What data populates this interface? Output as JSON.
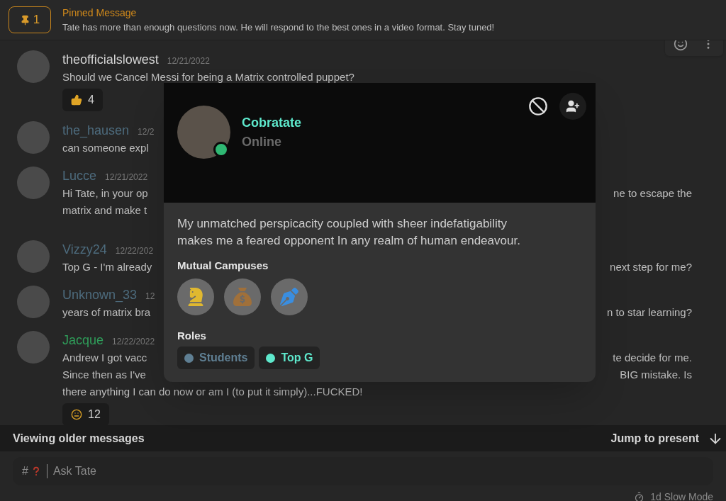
{
  "pinned": {
    "count": "1",
    "title": "Pinned Message",
    "text": "Tate has more than enough questions now. He will respond to the best ones in a video format. Stay tuned!"
  },
  "feed": [
    {
      "kind": "message",
      "author": "theofficialslowest",
      "color": "#d4d4d4",
      "date": "12/21/2022",
      "show_actions": true,
      "lines": [
        {
          "left": "Should we Cancel Messi for being a Matrix controlled puppet?"
        }
      ],
      "reaction": {
        "kind": "thumbs_up",
        "count": "4"
      }
    },
    {
      "kind": "message",
      "author": "the_hausen",
      "color": "#4d6b7d",
      "date": "12/2",
      "show_actions": false,
      "lines": [
        {
          "left": "can someone expl"
        }
      ]
    },
    {
      "kind": "message",
      "author": "Lucce",
      "color": "#4d6b7d",
      "date": "12/21/2022",
      "show_actions": false,
      "lines": [
        {
          "left": "Hi Tate, in your op",
          "right": "ne to escape the"
        },
        {
          "left": "matrix and make t"
        }
      ]
    },
    {
      "kind": "divider"
    },
    {
      "kind": "message",
      "author": "Vizzy24",
      "color": "#4d6b7d",
      "date": "12/22/202",
      "show_actions": false,
      "lines": [
        {
          "left": "Top G - I'm already",
          "right": "next step for me?"
        }
      ]
    },
    {
      "kind": "message",
      "author": "Unknown_33",
      "color": "#4d6b7d",
      "date": "12",
      "show_actions": false,
      "lines": [
        {
          "left": "years of matrix bra",
          "right": "n to star learning?"
        }
      ]
    },
    {
      "kind": "message",
      "author": "Jacque",
      "color": "#2f9e5a",
      "date": "12/22/2022",
      "show_actions": false,
      "lines": [
        {
          "left": "Andrew I got vacc",
          "right": "te decide for me."
        },
        {
          "left": "Since then as I've",
          "right": "BIG mistake. Is"
        },
        {
          "left": "there anything I can do now or am I (to put it simply)...FUCKED!"
        }
      ],
      "reaction": {
        "kind": "neutral_face",
        "count": "12"
      }
    }
  ],
  "profile": {
    "name": "Cobratate",
    "status": "Online",
    "online": true,
    "bio": "My unmatched perspicacity coupled with sheer indefatigability makes me a feared opponent In any realm of human endeavour.",
    "campuses_title": "Mutual Campuses",
    "campuses": [
      {
        "kind": "knight"
      },
      {
        "kind": "money"
      },
      {
        "kind": "pen"
      }
    ],
    "roles_title": "Roles",
    "roles": [
      {
        "name": "Students",
        "color": "#5f7f93"
      },
      {
        "name": "Top G",
        "color": "#5ee8cc"
      }
    ]
  },
  "older_bar": {
    "text": "Viewing older messages",
    "jump": "Jump to present"
  },
  "composer": {
    "prefix": "#",
    "placeholder": "Ask Tate"
  },
  "slow_mode": "1d Slow Mode"
}
